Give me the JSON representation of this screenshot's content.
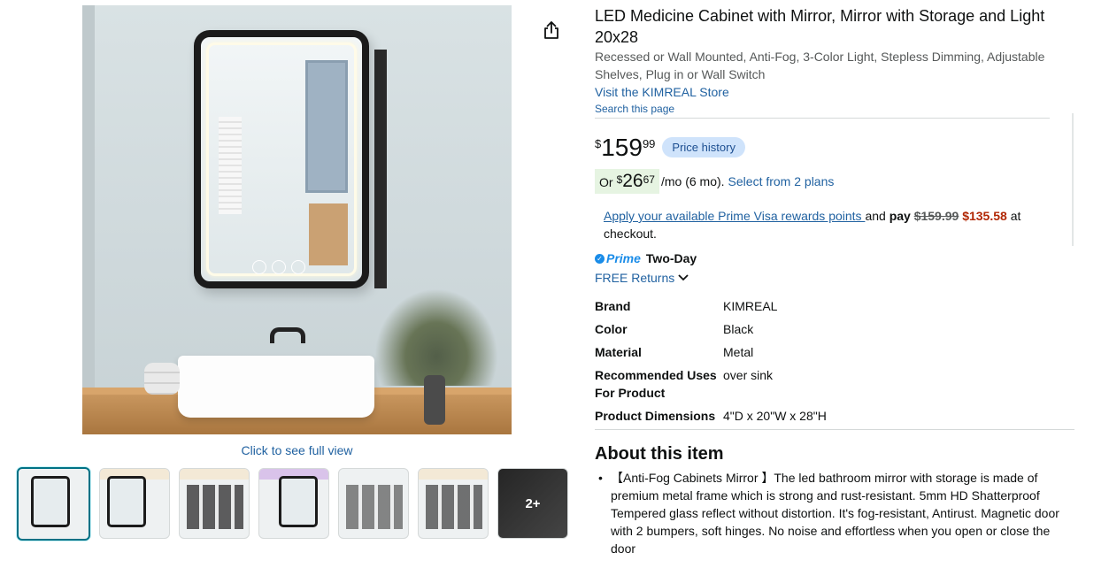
{
  "product": {
    "title": "LED Medicine Cabinet with Mirror, Mirror with Storage and Light 20x28",
    "subtitle": "Recessed or Wall Mounted, Anti-Fog, 3-Color Light, Stepless Dimming, Adjustable Shelves, Plug in or Wall Switch",
    "store_link": "Visit the KIMREAL Store",
    "search_page": "Search this page"
  },
  "gallery": {
    "click_full": "Click to see full view",
    "more_count": "2+",
    "thumbnail_count": 7,
    "selected_index": 0
  },
  "price": {
    "symbol": "$",
    "whole": "159",
    "fraction": "99",
    "history_label": "Price history"
  },
  "installment": {
    "or": "Or",
    "symbol": "$",
    "whole": "26",
    "fraction": "67",
    "per_month": "/mo (6 mo).",
    "plans_link": "Select from 2 plans"
  },
  "prime_visa": {
    "link": "Apply your available Prime Visa rewards points ",
    "and_pay": "and ",
    "pay": "pay",
    "old_price": "$159.99",
    "new_price": "$135.58",
    "suffix": "at checkout."
  },
  "delivery": {
    "prime": "Prime",
    "two_day": "Two-Day",
    "free_returns": "FREE Returns"
  },
  "specs": [
    {
      "key": "Brand",
      "value": "KIMREAL"
    },
    {
      "key": "Color",
      "value": "Black"
    },
    {
      "key": "Material",
      "value": "Metal"
    },
    {
      "key": "Recommended Uses For Product",
      "value": "over sink"
    },
    {
      "key": "Product Dimensions",
      "value": "4\"D x 20\"W x 28\"H"
    }
  ],
  "about": {
    "title": "About this item",
    "bullets": [
      "【Anti-Fog Cabinets Mirror 】The led bathroom mirror with storage is made of premium metal frame which is strong and rust-resistant. 5mm HD Shatterproof Tempered glass reflect without distortion. It's fog-resistant, Antirust. Magnetic door with 2 bumpers, soft hinges. No noise and effortless when you open or close the door"
    ]
  },
  "colors": {
    "link": "#2162a1",
    "deal_price": "#b12704",
    "prime_blue": "#1a8ce8",
    "selected_border": "#007185",
    "price_history_bg": "#cfe3fb",
    "installment_bg": "#e6f4e2"
  }
}
